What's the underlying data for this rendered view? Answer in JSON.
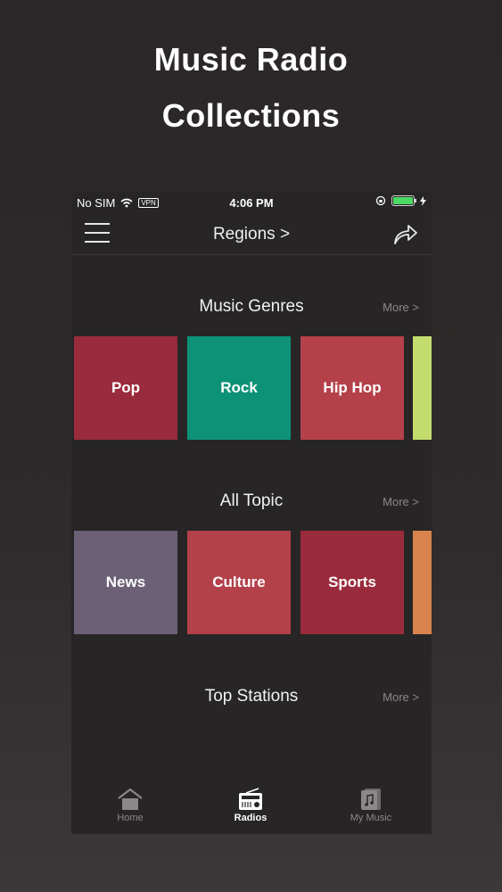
{
  "promo": {
    "title_line1": "Music Radio",
    "title_line2": "Collections"
  },
  "status_bar": {
    "carrier": "No SIM",
    "vpn": "VPN",
    "time": "4:06 PM",
    "battery_level": 1.0
  },
  "navbar": {
    "title": "Regions >"
  },
  "sections": [
    {
      "title": "Music Genres",
      "more": "More >",
      "tiles": [
        {
          "label": "Pop",
          "color": "#9a2b3c"
        },
        {
          "label": "Rock",
          "color": "#0d9277"
        },
        {
          "label": "Hip Hop",
          "color": "#b4414a"
        },
        {
          "label": "",
          "color": "#c4dc6e"
        }
      ]
    },
    {
      "title": "All Topic",
      "more": "More >",
      "tiles": [
        {
          "label": "News",
          "color": "#6b6076"
        },
        {
          "label": "Culture",
          "color": "#b4414a"
        },
        {
          "label": "Sports",
          "color": "#9a2b3c"
        },
        {
          "label": "",
          "color": "#d8844c"
        }
      ]
    },
    {
      "title": "Top Stations",
      "more": "More >"
    }
  ],
  "tabbar": {
    "tabs": [
      {
        "label": "Home",
        "icon": "home-icon",
        "active": false
      },
      {
        "label": "Radios",
        "icon": "radio-icon",
        "active": true
      },
      {
        "label": "My Music",
        "icon": "music-file-icon",
        "active": false
      }
    ]
  }
}
